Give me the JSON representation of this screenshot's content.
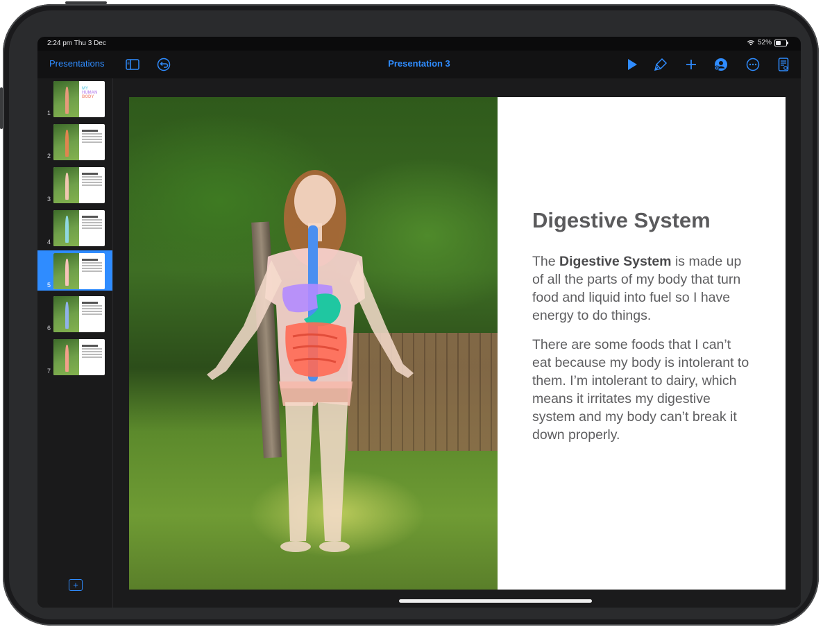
{
  "status_bar": {
    "time": "2:24 pm  Thu 3 Dec",
    "battery": "52%",
    "battery_level": 0.52
  },
  "toolbar": {
    "back_label": "Presentations",
    "title": "Presentation 3",
    "icons": [
      "sidebar-toggle-icon",
      "undo-icon",
      "play-icon",
      "format-brush-icon",
      "plus-icon",
      "collaborate-icon",
      "more-icon",
      "document-icon"
    ]
  },
  "sidebar": {
    "slides": [
      {
        "number": "1"
      },
      {
        "number": "2"
      },
      {
        "number": "3"
      },
      {
        "number": "4"
      },
      {
        "number": "5",
        "selected": true
      },
      {
        "number": "6"
      },
      {
        "number": "7"
      }
    ],
    "add_slide_icon": "plus-square-icon"
  },
  "slide": {
    "title": "Digestive System",
    "paragraph1_prefix": "The ",
    "paragraph1_bold": "Digestive System",
    "paragraph1_suffix": " is made up of all the parts of my body that turn food and liquid into fuel so I have energy to do things.",
    "paragraph2": "There are some foods that I can’t eat because my body is intolerant to them. I’m intolerant to dairy, which means it irritates my digestive system and my body can’t break it down properly."
  },
  "colors": {
    "accent": "#2f8cff",
    "stomach": "#1fc7a1",
    "liver": "#b38bff",
    "intestine": "#ff6a55",
    "esophagus": "#4a8ff0"
  }
}
